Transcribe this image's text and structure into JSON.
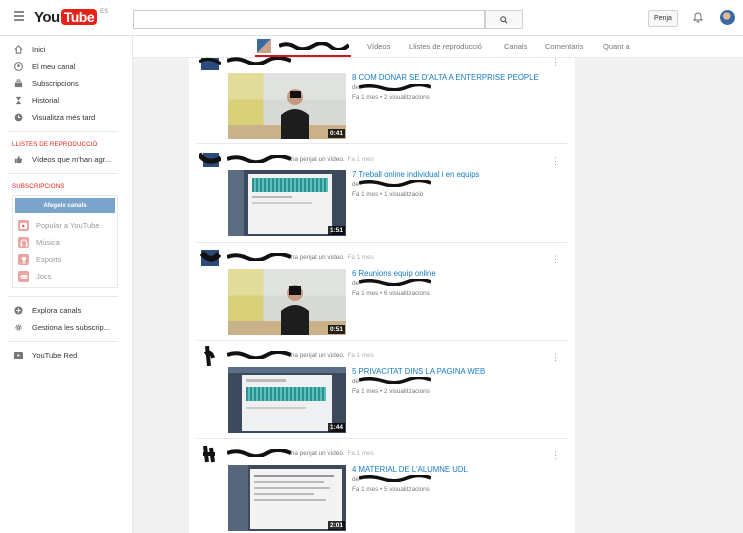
{
  "header": {
    "logo_you": "You",
    "logo_tube": "Tube",
    "logo_country": "ES",
    "search_placeholder": "",
    "upload_label": "Penja"
  },
  "sidebar": {
    "items": [
      {
        "label": "Inici",
        "icon": "home-icon"
      },
      {
        "label": "El meu canal",
        "icon": "account-icon"
      },
      {
        "label": "Subscripcions",
        "icon": "subscriptions-icon"
      },
      {
        "label": "Historial",
        "icon": "history-icon"
      },
      {
        "label": "Visualitza més tard",
        "icon": "watch-later-icon"
      }
    ],
    "playlists_heading": "LLISTES DE REPRODUCCIÓ",
    "playlists": [
      {
        "label": "Vídeos que m'han agr...",
        "icon": "thumbs-up-icon"
      }
    ],
    "subscriptions_heading": "SUBSCRIPCIONS",
    "add_channels_label": "Afegeix canals",
    "subscriptions": [
      {
        "label": "Popular a YouTube",
        "color": "#e62117"
      },
      {
        "label": "Música",
        "color": "#e62117"
      },
      {
        "label": "Esports",
        "color": "#e62117"
      },
      {
        "label": "Jocs",
        "color": "#e62117"
      }
    ],
    "bottom_items": [
      {
        "label": "Explora canals",
        "icon": "explore-icon"
      },
      {
        "label": "Gestiona les subscrip...",
        "icon": "gear-icon"
      }
    ],
    "red_items": [
      {
        "label": "YouTube Red",
        "icon": "youtube-red-icon"
      }
    ]
  },
  "channel_nav": {
    "tabs": [
      "Vídeos",
      "Llistes de reproducció",
      "Canals",
      "Comentaris",
      "Quant a"
    ]
  },
  "feed": {
    "posts": [
      {
        "action": "ha penjat un vídeo.",
        "time": "",
        "title": "8 COM DONAR SE D'ALTA A ENTERPRISE PEOPLE",
        "by": "de",
        "meta": "Fa 1 mes • 2 visualitzacions",
        "duration": "0:41"
      },
      {
        "action": "ha penjat un vídeo.",
        "time": "Fa 1 mes",
        "title": "7 Treball online individual i en equips",
        "by": "de",
        "meta": "Fa 1 mes • 1 visualització",
        "duration": "1:51"
      },
      {
        "action": "ha penjat un vídeo.",
        "time": "Fa 1 mes",
        "title": "6 Reunions equip online",
        "by": "de",
        "meta": "Fa 1 mes • 6 visualitzacions",
        "duration": "0:51"
      },
      {
        "action": "ha penjat un vídeo.",
        "time": "Fa 1 mes",
        "title": "5 PRIVACITAT DINS LA PAGINA WEB",
        "by": "de",
        "meta": "Fa 1 mes • 2 visualitzacions",
        "duration": "1:44"
      },
      {
        "action": "ha penjat un vídeo.",
        "time": "Fa 1 mes",
        "title": "4 MATERIAL DE L'ALUMNE UDL",
        "by": "de",
        "meta": "Fa 1 mes • 5 visualitzacions",
        "duration": "2:01"
      }
    ]
  },
  "colors": {
    "brand": "#e62117",
    "link": "#167ac6",
    "accent_button": "#7ba4cc"
  }
}
